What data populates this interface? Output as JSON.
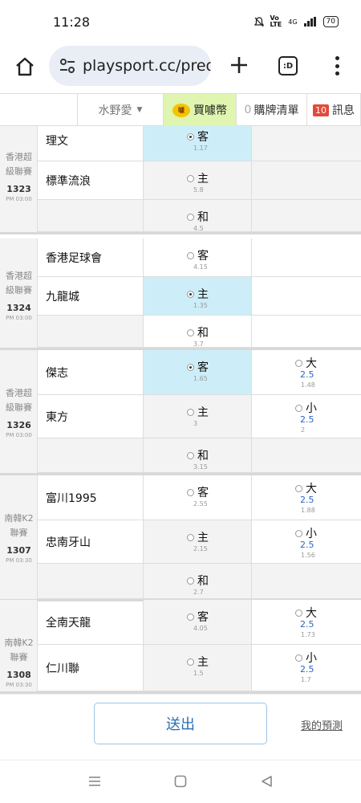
{
  "status_bar": {
    "time": "11:28",
    "signal_text": "4G",
    "battery": "70"
  },
  "browser": {
    "url": "playsport.cc/pred",
    "tabs_label": ":D"
  },
  "site_nav": {
    "user": "水野愛",
    "coins_label": "買噱幣",
    "coin_icon_text": "噱",
    "cart_count": "0",
    "cart_label": "購牌清單",
    "messages_count": "10",
    "messages_label": "訊息"
  },
  "matches": [
    {
      "league": [
        "香港超",
        "級聯賽"
      ],
      "number": "1323",
      "time": "PM 03:00",
      "rows": [
        {
          "team": "理文",
          "bet": {
            "label": "客",
            "odds": "1.17",
            "selected": true
          },
          "ou": null
        },
        {
          "team": "標準流浪",
          "bet": {
            "label": "主",
            "odds": "5.8",
            "selected": false
          },
          "ou": null
        },
        {
          "team": "",
          "bet": {
            "label": "和",
            "odds": "4.5",
            "selected": false
          },
          "ou": null
        }
      ]
    },
    {
      "league": [
        "香港超",
        "級聯賽"
      ],
      "number": "1324",
      "time": "PM 03:00",
      "rows": [
        {
          "team": "香港足球會",
          "bet": {
            "label": "客",
            "odds": "4.15",
            "selected": false
          },
          "ou": null
        },
        {
          "team": "九龍城",
          "bet": {
            "label": "主",
            "odds": "1.35",
            "selected": true
          },
          "ou": null
        },
        {
          "team": "",
          "bet": {
            "label": "和",
            "odds": "3.7",
            "selected": false
          },
          "ou": null
        }
      ]
    },
    {
      "league": [
        "香港超",
        "級聯賽"
      ],
      "number": "1326",
      "time": "PM 03:00",
      "rows": [
        {
          "team": "傑志",
          "bet": {
            "label": "客",
            "odds": "1.65",
            "selected": true
          },
          "ou": {
            "label": "大",
            "line": "2.5",
            "odds": "1.48"
          }
        },
        {
          "team": "東方",
          "bet": {
            "label": "主",
            "odds": "3",
            "selected": false
          },
          "ou": {
            "label": "小",
            "line": "2.5",
            "odds": "2"
          }
        },
        {
          "team": "",
          "bet": {
            "label": "和",
            "odds": "3.15",
            "selected": false
          },
          "ou": null
        }
      ]
    },
    {
      "league": [
        "南韓K2",
        "聯賽"
      ],
      "number": "1307",
      "time": "PM 03:30",
      "rows": [
        {
          "team": "富川1995",
          "bet": {
            "label": "客",
            "odds": "2.55",
            "selected": false
          },
          "ou": {
            "label": "大",
            "line": "2.5",
            "odds": "1.88"
          }
        },
        {
          "team": "忠南牙山",
          "bet": {
            "label": "主",
            "odds": "2.15",
            "selected": false
          },
          "ou": {
            "label": "小",
            "line": "2.5",
            "odds": "1.56"
          }
        },
        {
          "team": "",
          "bet": {
            "label": "和",
            "odds": "2.7",
            "selected": false
          },
          "ou": null
        }
      ]
    },
    {
      "league": [
        "南韓K2",
        "聯賽"
      ],
      "number": "1308",
      "time": "PM 03:30",
      "rows": [
        {
          "team": "全南天龍",
          "bet": {
            "label": "客",
            "odds": "4.05",
            "selected": false
          },
          "ou": {
            "label": "大",
            "line": "2.5",
            "odds": "1.73"
          }
        },
        {
          "team": "仁川聯",
          "bet": {
            "label": "主",
            "odds": "1.5",
            "selected": false
          },
          "ou": {
            "label": "小",
            "line": "2.5",
            "odds": "1.7"
          }
        }
      ]
    }
  ],
  "actions": {
    "submit_label": "送出",
    "my_predictions_label": "我的預測"
  },
  "colors": {
    "selected": "#cdeef8",
    "coins_bg": "#dff5b0",
    "line_blue": "#2a66c8",
    "badge_red": "#e24a3b"
  }
}
